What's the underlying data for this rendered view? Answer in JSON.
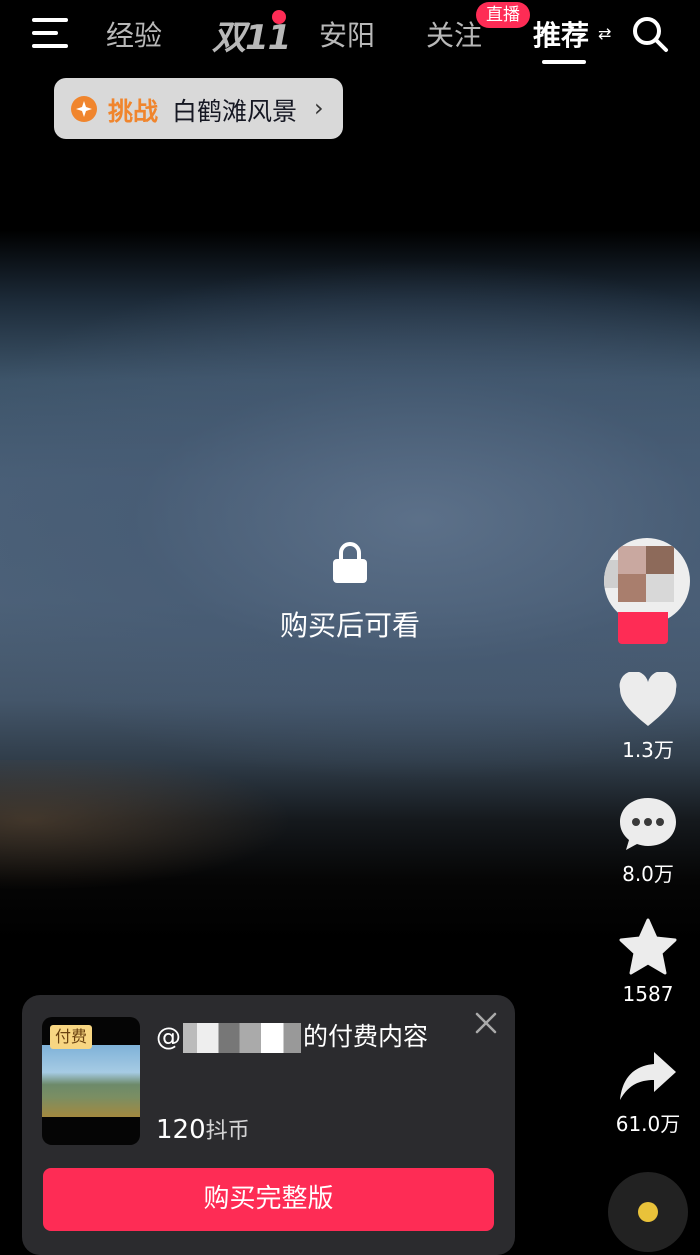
{
  "nav": {
    "tabs": [
      {
        "label": "经验"
      },
      {
        "label": "双11"
      },
      {
        "label": "安阳"
      },
      {
        "label": "关注",
        "badge": "直播"
      },
      {
        "label": "推荐",
        "active": true
      }
    ],
    "switch_glyph": "⇄",
    "icons": [
      "menu-icon",
      "search-icon"
    ],
    "accent_color": "#fe2c55"
  },
  "challenge": {
    "tag": "挑战",
    "name": "白鹤滩风景",
    "chevron": "›"
  },
  "locked": {
    "icon": "lock-icon",
    "text": "购买后可看"
  },
  "rail": {
    "likes": "1.3万",
    "comments": "8.0万",
    "favorites": "1587",
    "shares": "61.0万"
  },
  "paid": {
    "badge": "付费",
    "title_prefix": "@",
    "title_suffix": "的付费内容",
    "price": "120",
    "price_unit": "抖币",
    "buy_label": "购买完整版",
    "close_icon": "close-icon"
  }
}
